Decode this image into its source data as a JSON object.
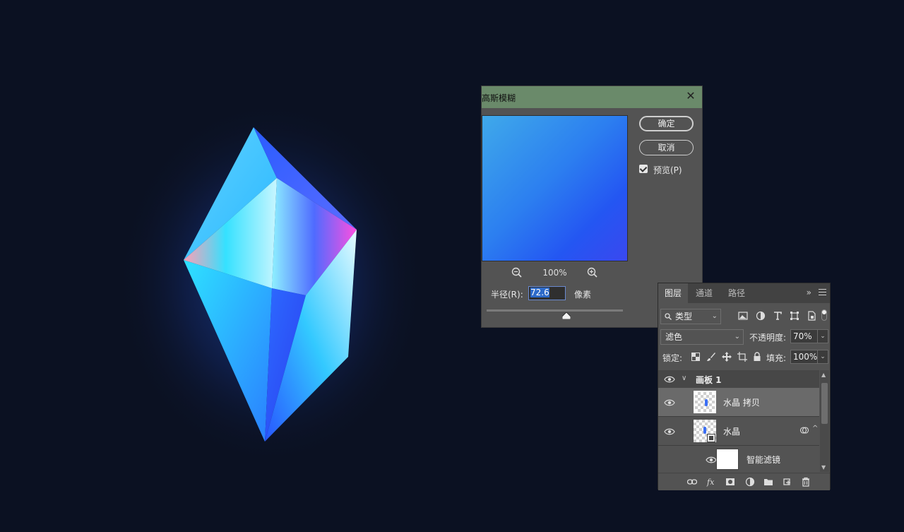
{
  "dialog": {
    "title": "高斯模糊",
    "ok_label": "确定",
    "cancel_label": "取消",
    "preview_label": "预览(P)",
    "preview_checked": true,
    "zoom_percent": "100%",
    "radius_label": "半径(R):",
    "radius_value": "72.6",
    "radius_unit": "像素",
    "preview_gradient": [
      "#3fa9ea",
      "#2c7ff0",
      "#2456f2",
      "#3a48ef"
    ]
  },
  "layers_panel": {
    "tabs": [
      {
        "label": "图层",
        "active": true
      },
      {
        "label": "通道",
        "active": false
      },
      {
        "label": "路径",
        "active": false
      }
    ],
    "more_label": "»",
    "filter_kind": "类型",
    "blend_mode": "滤色",
    "opacity_label": "不透明度:",
    "opacity_value": "70%",
    "lock_label": "锁定:",
    "fill_label": "填充:",
    "fill_value": "100%",
    "group": {
      "name": "画板 1",
      "expanded": true
    },
    "layers": [
      {
        "name": "水晶 拷贝",
        "selected": true,
        "smart_object": false
      },
      {
        "name": "水晶",
        "selected": false,
        "smart_object": true
      },
      {
        "name": "智能滤镜",
        "selected": false,
        "is_filter_mask": true
      }
    ]
  },
  "canvas": {
    "background": "#0b1122"
  }
}
